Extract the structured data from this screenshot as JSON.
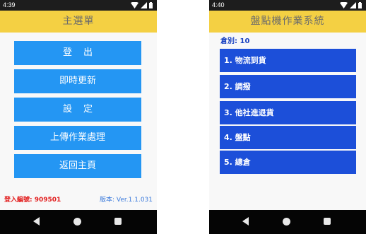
{
  "left_screen": {
    "status_bar": {
      "time": "4:39"
    },
    "title": "主選單",
    "buttons": [
      {
        "label": "登出"
      },
      {
        "label": "即時更新"
      },
      {
        "label": "設定"
      },
      {
        "label": "上傳作業處理"
      },
      {
        "label": "返回主頁"
      }
    ],
    "footer": {
      "login_label": "登入編號: 909501",
      "version_label": "版本: Ver.1.1.031"
    }
  },
  "right_screen": {
    "status_bar": {
      "time": "4:40"
    },
    "title": "盤點機作業系統",
    "warehouse_label": "倉別: 10",
    "menu_items": [
      {
        "label": "1. 物流到貨"
      },
      {
        "label": "2. 調撥"
      },
      {
        "label": "3. 他社進退貨"
      },
      {
        "label": "4. 盤點"
      },
      {
        "label": "5. 總倉"
      }
    ]
  },
  "colors": {
    "app_bar": "#f4d043",
    "left_buttons": "#2496f3",
    "right_menu_items": "#1c4fd9",
    "login_text": "#e21d1d",
    "version_text": "#3c7bdc",
    "status_bar": "#1d1d1d",
    "nav_bar": "#050505"
  },
  "icons": {
    "status_bar": [
      "wifi-icon",
      "signal-icon",
      "battery-icon"
    ],
    "nav_bar": [
      "back-icon",
      "home-icon",
      "recents-icon"
    ]
  }
}
